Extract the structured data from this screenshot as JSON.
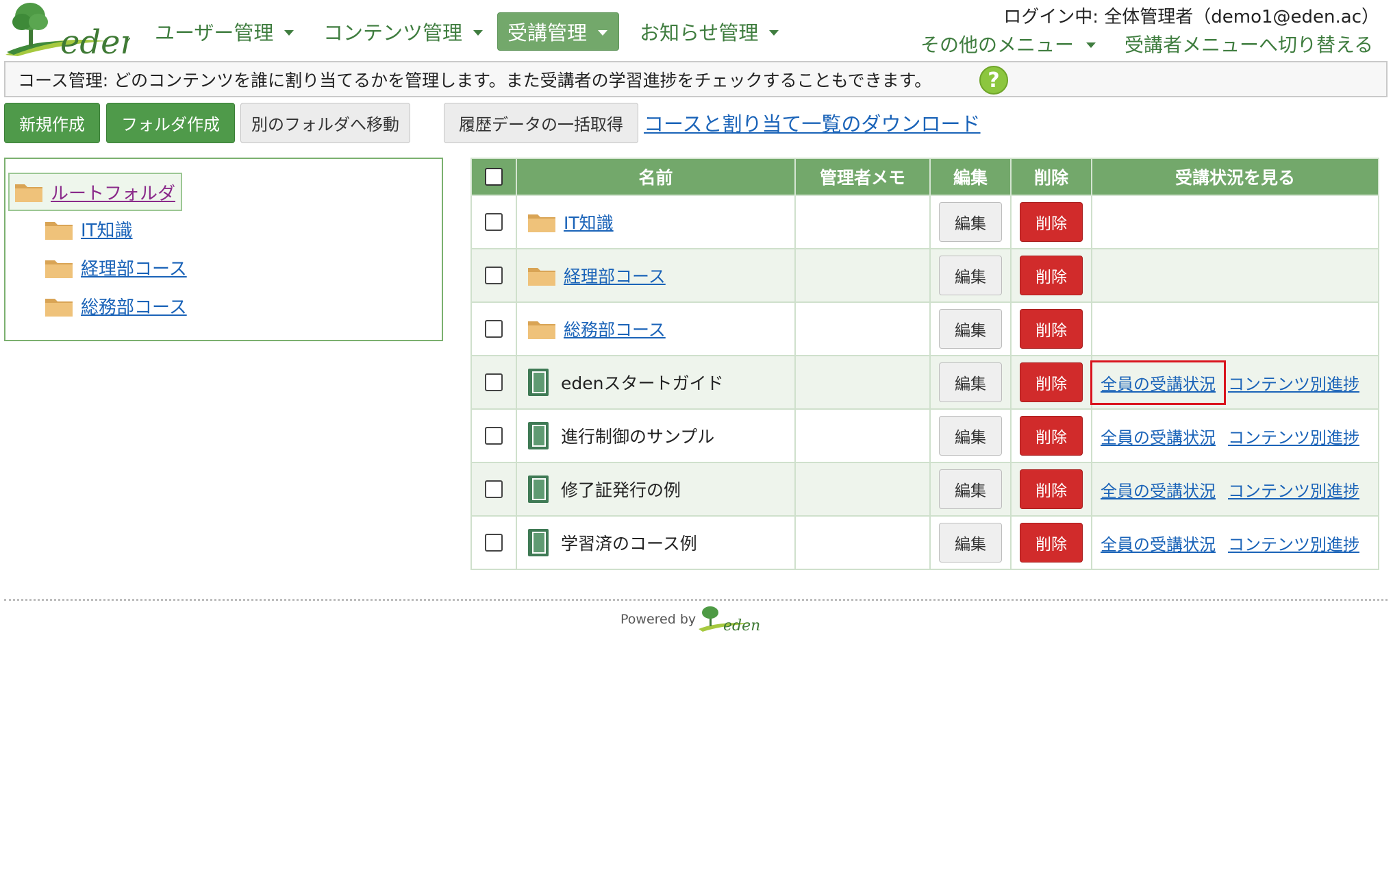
{
  "header": {
    "nav": [
      {
        "label": "ユーザー管理",
        "active": false
      },
      {
        "label": "コンテンツ管理",
        "active": false
      },
      {
        "label": "受講管理",
        "active": true
      },
      {
        "label": "お知らせ管理",
        "active": false
      }
    ],
    "login_status": "ログイン中: 全体管理者（demo1@eden.ac）",
    "other_menu": "その他のメニュー",
    "switch_menu": "受講者メニューへ切り替える"
  },
  "info_bar": {
    "text": "コース管理: どのコンテンツを誰に割り当てるかを管理します。また受講者の学習進捗をチェックすることもできます。",
    "help_symbol": "?"
  },
  "toolbar": {
    "new_label": "新規作成",
    "folder_label": "フォルダ作成",
    "move_label": "別のフォルダへ移動",
    "history_label": "履歴データの一括取得",
    "download_link": "コースと割り当て一覧のダウンロード"
  },
  "tree": {
    "root": "ルートフォルダ",
    "children": [
      "IT知識",
      "経理部コース",
      "総務部コース"
    ]
  },
  "table": {
    "headers": {
      "name": "名前",
      "memo": "管理者メモ",
      "edit": "編集",
      "delete": "削除",
      "status": "受講状況を見る"
    },
    "rows": [
      {
        "type": "folder",
        "name": "IT知識",
        "memo": ""
      },
      {
        "type": "folder",
        "name": "経理部コース",
        "memo": ""
      },
      {
        "type": "folder",
        "name": "総務部コース",
        "memo": ""
      },
      {
        "type": "course",
        "name": "edenスタートガイド",
        "memo": "",
        "highlighted": true
      },
      {
        "type": "course",
        "name": "進行制御のサンプル",
        "memo": ""
      },
      {
        "type": "course",
        "name": "修了証発行の例",
        "memo": ""
      },
      {
        "type": "course",
        "name": "学習済のコース例",
        "memo": ""
      }
    ],
    "edit_label": "編集",
    "delete_label": "削除",
    "all_status_label": "全員の受講状況",
    "content_progress_label": "コンテンツ別進捗"
  },
  "footer": {
    "powered_by": "Powered by",
    "brand": "eden"
  },
  "brand": {
    "logo_text": "eden"
  },
  "colors": {
    "accent_green": "#73a86b",
    "link_blue": "#1a63b8",
    "delete_red": "#d12b2b",
    "highlight_red": "#d9141d"
  }
}
